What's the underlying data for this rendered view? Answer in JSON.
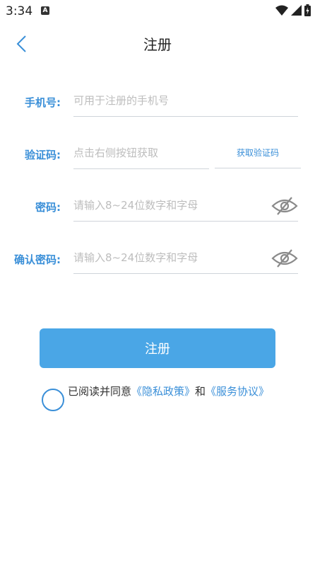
{
  "status": {
    "time": "3:34",
    "notification": "A"
  },
  "nav": {
    "title": "注册"
  },
  "form": {
    "phone": {
      "label": "手机号:",
      "placeholder": "可用于注册的手机号"
    },
    "code": {
      "label": "验证码:",
      "placeholder": "点击右侧按钮获取",
      "button": "获取验证码"
    },
    "password": {
      "label": "密码:",
      "placeholder": "请输入8~24位数字和字母"
    },
    "confirm": {
      "label": "确认密码:",
      "placeholder": "请输入8~24位数字和字母"
    }
  },
  "submit_label": "注册",
  "agreement": {
    "prefix": "已阅读并同意",
    "privacy": "《隐私政策》",
    "and": "和",
    "service": "《服务协议》"
  },
  "colors": {
    "accent": "#3a8fd8",
    "button": "#4aa6e6"
  }
}
